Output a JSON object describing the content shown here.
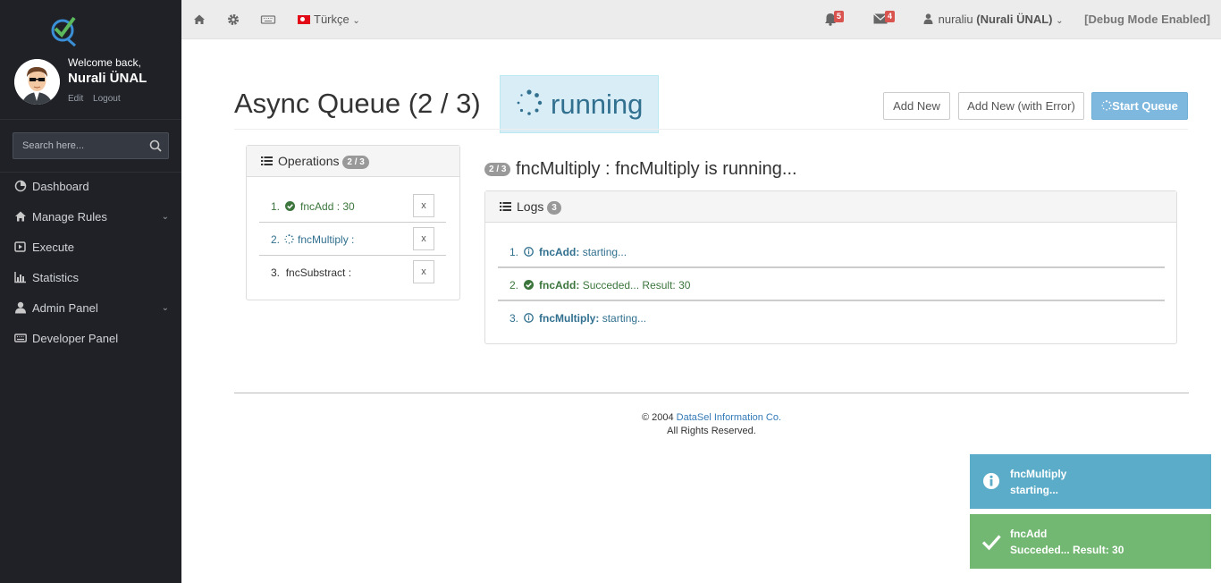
{
  "sidebar": {
    "welcome": "Welcome back,",
    "user_name": "Nurali ÜNAL",
    "edit_label": "Edit",
    "logout_label": "Logout",
    "search_placeholder": "Search here...",
    "items": [
      {
        "label": "Dashboard",
        "icon": "dashboard-icon",
        "has_submenu": false
      },
      {
        "label": "Manage Rules",
        "icon": "home-icon",
        "has_submenu": true
      },
      {
        "label": "Execute",
        "icon": "play-icon",
        "has_submenu": false
      },
      {
        "label": "Statistics",
        "icon": "bar-chart-icon",
        "has_submenu": false
      },
      {
        "label": "Admin Panel",
        "icon": "user-icon",
        "has_submenu": true
      },
      {
        "label": "Developer Panel",
        "icon": "keyboard-icon",
        "has_submenu": false
      }
    ]
  },
  "topbar": {
    "language": "Türkçe",
    "notifications_count": "5",
    "messages_count": "4",
    "username": "nuraliu",
    "full_name": "(Nurali ÜNAL)",
    "debug_label": "[Debug Mode Enabled]"
  },
  "main": {
    "title": "Async Queue (2 / 3)",
    "status": "running",
    "add_new_label": "Add New",
    "add_new_error_label": "Add New (with Error)",
    "start_queue_label": "Start Queue",
    "operations": {
      "heading": "Operations",
      "badge": "2 / 3",
      "items": [
        {
          "num": "1.",
          "text": "fncAdd : 30",
          "state": "done",
          "remove": "x"
        },
        {
          "num": "2.",
          "text": "fncMultiply :",
          "state": "running",
          "remove": "x"
        },
        {
          "num": "3.",
          "text": "fncSubstract :",
          "state": "pending",
          "remove": "x"
        }
      ]
    },
    "current": {
      "badge": "2 / 3",
      "text": "fncMultiply : fncMultiply is running..."
    },
    "logs": {
      "heading": "Logs",
      "count": "3",
      "items": [
        {
          "num": "1.",
          "name": "fncAdd:",
          "msg": "starting...",
          "type": "info"
        },
        {
          "num": "2.",
          "name": "fncAdd:",
          "msg": "Succeded... Result: 30",
          "type": "success"
        },
        {
          "num": "3.",
          "name": "fncMultiply:",
          "msg": "starting...",
          "type": "info"
        }
      ]
    }
  },
  "footer": {
    "copyright": "© 2004",
    "company": "DataSel Information Co.",
    "rights": "All Rights Reserved."
  },
  "toasts": [
    {
      "title": "fncMultiply",
      "message": "starting...",
      "type": "info",
      "color": "#5bacc8"
    },
    {
      "title": "fncAdd",
      "message": "Succeded... Result: 30",
      "type": "success",
      "color": "#72b772"
    }
  ],
  "colors": {
    "sidebar_bg": "#1f2127",
    "info": "#31708f",
    "success": "#3c763d",
    "danger": "#d9534f",
    "link": "#337ab7"
  }
}
